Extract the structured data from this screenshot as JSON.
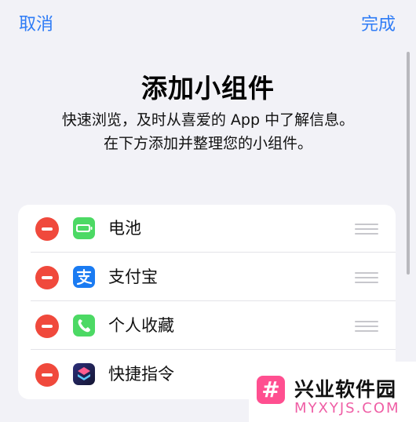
{
  "nav": {
    "cancel_label": "取消",
    "done_label": "完成"
  },
  "header": {
    "title": "添加小组件",
    "subtitle_line1": "快速浏览，及时从喜爱的 App 中了解信息。",
    "subtitle_line2": "在下方添加并整理您的小组件。"
  },
  "widgets": [
    {
      "label": "电池",
      "icon": "battery-icon"
    },
    {
      "label": "支付宝",
      "icon": "alipay-icon"
    },
    {
      "label": "个人收藏",
      "icon": "phone-icon"
    },
    {
      "label": "快捷指令",
      "icon": "shortcuts-icon"
    }
  ],
  "watermark": {
    "title": "兴业软件园",
    "url": "MYXYJS.COM",
    "logo_glyph": "#"
  },
  "colors": {
    "accent": "#2f7cf6",
    "remove": "#f0493c",
    "background": "#f2f2f7"
  }
}
